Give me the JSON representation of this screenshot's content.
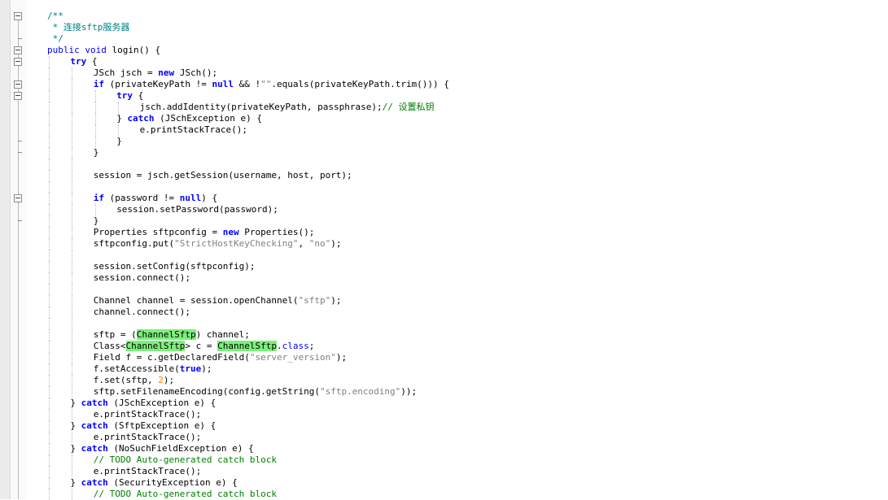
{
  "editor": {
    "language": "java",
    "colors": {
      "keyword": "#0000ff",
      "string": "#808080",
      "comment": "#008000",
      "doc_comment": "#008080",
      "number": "#ff8000",
      "highlight": "#7cf07c",
      "gutter": "#ececec"
    },
    "lines": [
      {
        "indent": 0,
        "fold": "open",
        "tokens": [
          {
            "t": "/**",
            "c": "doc"
          }
        ]
      },
      {
        "indent": 0,
        "fold": "none",
        "tokens": [
          {
            "t": " * 连接sftp服务器",
            "c": "doc"
          }
        ]
      },
      {
        "indent": 0,
        "fold": "end",
        "tokens": [
          {
            "t": " */",
            "c": "doc"
          }
        ]
      },
      {
        "indent": 0,
        "fold": "open",
        "tokens": [
          {
            "t": "public",
            "c": "kw2"
          },
          {
            "t": " ",
            "c": ""
          },
          {
            "t": "void",
            "c": "kw2"
          },
          {
            "t": " login() {",
            "c": ""
          }
        ]
      },
      {
        "indent": 1,
        "fold": "open",
        "tokens": [
          {
            "t": "try",
            "c": "kw"
          },
          {
            "t": " {",
            "c": ""
          }
        ]
      },
      {
        "indent": 2,
        "fold": "none",
        "tokens": [
          {
            "t": "JSch jsch = ",
            "c": ""
          },
          {
            "t": "new",
            "c": "kw"
          },
          {
            "t": " JSch();",
            "c": ""
          }
        ]
      },
      {
        "indent": 2,
        "fold": "open",
        "tokens": [
          {
            "t": "if",
            "c": "kw"
          },
          {
            "t": " (privateKeyPath != ",
            "c": ""
          },
          {
            "t": "null",
            "c": "kw"
          },
          {
            "t": " && !",
            "c": ""
          },
          {
            "t": "\"\"",
            "c": "str"
          },
          {
            "t": ".equals(privateKeyPath.trim())) {",
            "c": ""
          }
        ]
      },
      {
        "indent": 3,
        "fold": "open",
        "tokens": [
          {
            "t": "try",
            "c": "kw"
          },
          {
            "t": " {",
            "c": ""
          }
        ]
      },
      {
        "indent": 4,
        "fold": "none",
        "tokens": [
          {
            "t": "jsch.addIdentity(privateKeyPath, passphrase);",
            "c": ""
          },
          {
            "t": "// 设置私钥",
            "c": "cm"
          }
        ]
      },
      {
        "indent": 3,
        "fold": "none",
        "tokens": [
          {
            "t": "} ",
            "c": ""
          },
          {
            "t": "catch",
            "c": "kw"
          },
          {
            "t": " (JSchException e) {",
            "c": ""
          }
        ]
      },
      {
        "indent": 4,
        "fold": "none",
        "tokens": [
          {
            "t": "e.printStackTrace();",
            "c": ""
          }
        ]
      },
      {
        "indent": 3,
        "fold": "end",
        "tokens": [
          {
            "t": "}",
            "c": ""
          }
        ]
      },
      {
        "indent": 2,
        "fold": "end",
        "tokens": [
          {
            "t": "}",
            "c": ""
          }
        ]
      },
      {
        "indent": 2,
        "fold": "none",
        "tokens": []
      },
      {
        "indent": 2,
        "fold": "none",
        "tokens": [
          {
            "t": "session = jsch.getSession(username, host, port);",
            "c": ""
          }
        ]
      },
      {
        "indent": 2,
        "fold": "none",
        "tokens": []
      },
      {
        "indent": 2,
        "fold": "open",
        "tokens": [
          {
            "t": "if",
            "c": "kw"
          },
          {
            "t": " (password != ",
            "c": ""
          },
          {
            "t": "null",
            "c": "kw"
          },
          {
            "t": ") {",
            "c": ""
          }
        ]
      },
      {
        "indent": 3,
        "fold": "none",
        "tokens": [
          {
            "t": "session.setPassword(password);",
            "c": ""
          }
        ]
      },
      {
        "indent": 2,
        "fold": "end",
        "tokens": [
          {
            "t": "}",
            "c": ""
          }
        ]
      },
      {
        "indent": 2,
        "fold": "none",
        "tokens": [
          {
            "t": "Properties sftpconfig = ",
            "c": ""
          },
          {
            "t": "new",
            "c": "kw"
          },
          {
            "t": " Properties();",
            "c": ""
          }
        ]
      },
      {
        "indent": 2,
        "fold": "none",
        "tokens": [
          {
            "t": "sftpconfig.put(",
            "c": ""
          },
          {
            "t": "\"StrictHostKeyChecking\"",
            "c": "str"
          },
          {
            "t": ", ",
            "c": ""
          },
          {
            "t": "\"no\"",
            "c": "str"
          },
          {
            "t": ");",
            "c": ""
          }
        ]
      },
      {
        "indent": 2,
        "fold": "none",
        "tokens": []
      },
      {
        "indent": 2,
        "fold": "none",
        "tokens": [
          {
            "t": "session.setConfig(sftpconfig);",
            "c": ""
          }
        ]
      },
      {
        "indent": 2,
        "fold": "none",
        "tokens": [
          {
            "t": "session.connect();",
            "c": ""
          }
        ]
      },
      {
        "indent": 2,
        "fold": "none",
        "tokens": []
      },
      {
        "indent": 2,
        "fold": "none",
        "tokens": [
          {
            "t": "Channel channel = session.openChannel(",
            "c": ""
          },
          {
            "t": "\"sftp\"",
            "c": "str"
          },
          {
            "t": ");",
            "c": ""
          }
        ]
      },
      {
        "indent": 2,
        "fold": "none",
        "tokens": [
          {
            "t": "channel.connect();",
            "c": ""
          }
        ]
      },
      {
        "indent": 2,
        "fold": "none",
        "tokens": []
      },
      {
        "indent": 2,
        "fold": "none",
        "tokens": [
          {
            "t": "sftp = (",
            "c": ""
          },
          {
            "t": "ChannelSftp",
            "c": "hl"
          },
          {
            "t": ") channel;",
            "c": ""
          }
        ]
      },
      {
        "indent": 2,
        "fold": "none",
        "tokens": [
          {
            "t": "Class<",
            "c": ""
          },
          {
            "t": "ChannelSftp",
            "c": "hl"
          },
          {
            "t": "> c = ",
            "c": ""
          },
          {
            "t": "ChannelSftp",
            "c": "hl"
          },
          {
            "t": ".",
            "c": ""
          },
          {
            "t": "class",
            "c": "kw2"
          },
          {
            "t": ";",
            "c": ""
          }
        ]
      },
      {
        "indent": 2,
        "fold": "none",
        "tokens": [
          {
            "t": "Field f = c.getDeclaredField(",
            "c": ""
          },
          {
            "t": "\"server_version\"",
            "c": "str"
          },
          {
            "t": ");",
            "c": ""
          }
        ]
      },
      {
        "indent": 2,
        "fold": "none",
        "tokens": [
          {
            "t": "f.setAccessible(",
            "c": ""
          },
          {
            "t": "true",
            "c": "kw"
          },
          {
            "t": ");",
            "c": ""
          }
        ]
      },
      {
        "indent": 2,
        "fold": "none",
        "tokens": [
          {
            "t": "f.set(sftp, ",
            "c": ""
          },
          {
            "t": "2",
            "c": "num"
          },
          {
            "t": ");",
            "c": ""
          }
        ]
      },
      {
        "indent": 2,
        "fold": "none",
        "tokens": [
          {
            "t": "sftp.setFilenameEncoding(config.getString(",
            "c": ""
          },
          {
            "t": "\"sftp.encoding\"",
            "c": "str"
          },
          {
            "t": "));",
            "c": ""
          }
        ]
      },
      {
        "indent": 1,
        "fold": "none",
        "tokens": [
          {
            "t": "} ",
            "c": ""
          },
          {
            "t": "catch",
            "c": "kw"
          },
          {
            "t": " (JSchException e) {",
            "c": ""
          }
        ]
      },
      {
        "indent": 2,
        "fold": "none",
        "tokens": [
          {
            "t": "e.printStackTrace();",
            "c": ""
          }
        ]
      },
      {
        "indent": 1,
        "fold": "none",
        "tokens": [
          {
            "t": "} ",
            "c": ""
          },
          {
            "t": "catch",
            "c": "kw"
          },
          {
            "t": " (SftpException e) {",
            "c": ""
          }
        ]
      },
      {
        "indent": 2,
        "fold": "none",
        "tokens": [
          {
            "t": "e.printStackTrace();",
            "c": ""
          }
        ]
      },
      {
        "indent": 1,
        "fold": "none",
        "tokens": [
          {
            "t": "} ",
            "c": ""
          },
          {
            "t": "catch",
            "c": "kw"
          },
          {
            "t": " (NoSuchFieldException e) {",
            "c": ""
          }
        ]
      },
      {
        "indent": 2,
        "fold": "none",
        "tokens": [
          {
            "t": "// TODO Auto-generated catch block",
            "c": "cm"
          }
        ]
      },
      {
        "indent": 2,
        "fold": "none",
        "tokens": [
          {
            "t": "e.printStackTrace();",
            "c": ""
          }
        ]
      },
      {
        "indent": 1,
        "fold": "none",
        "tokens": [
          {
            "t": "} ",
            "c": ""
          },
          {
            "t": "catch",
            "c": "kw"
          },
          {
            "t": " (SecurityException e) {",
            "c": ""
          }
        ]
      },
      {
        "indent": 2,
        "fold": "none",
        "tokens": [
          {
            "t": "// TODO Auto-generated catch block",
            "c": "cm"
          }
        ]
      }
    ]
  }
}
